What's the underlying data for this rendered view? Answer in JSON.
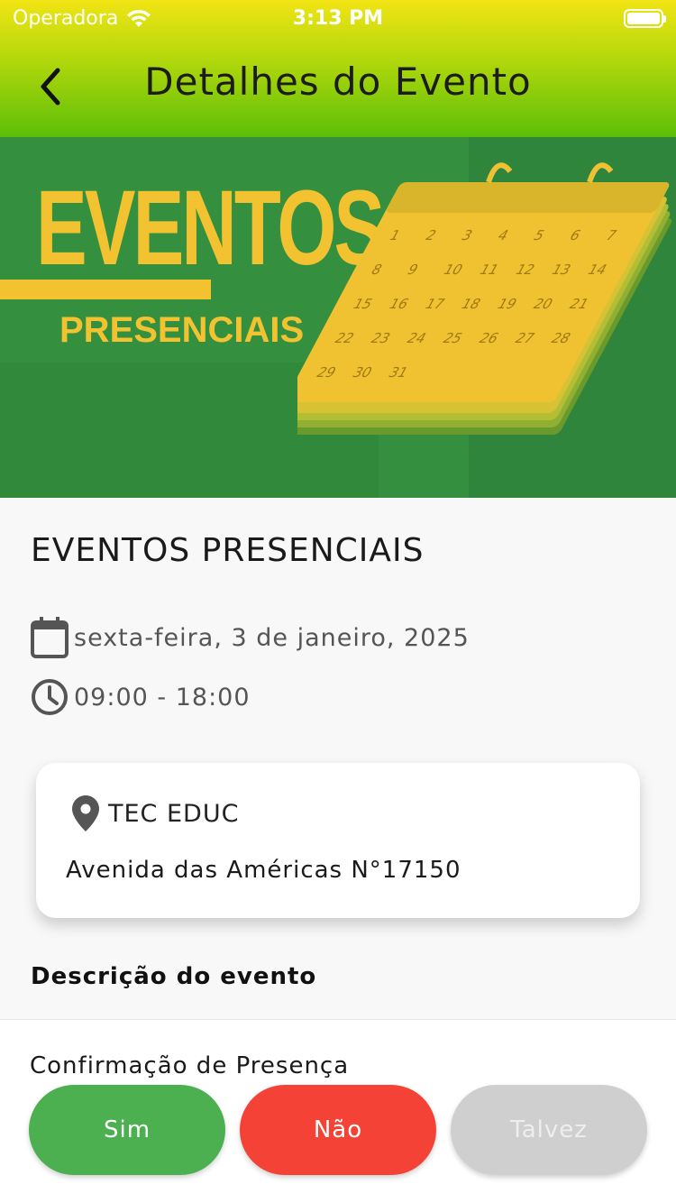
{
  "status_bar": {
    "carrier": "Operadora",
    "time": "3:13 PM"
  },
  "nav": {
    "title": "Detalhes do Evento"
  },
  "banner": {
    "title": "EVENTOS",
    "subtitle": "PRESENCIAIS",
    "calendar_days": [
      "1",
      "2",
      "3",
      "4",
      "5",
      "6",
      "7",
      "8",
      "9",
      "10",
      "11",
      "12",
      "13",
      "14",
      "15",
      "16",
      "17",
      "18",
      "19",
      "20",
      "21",
      "22",
      "23",
      "24",
      "25",
      "26",
      "27",
      "28",
      "29",
      "30",
      "31"
    ],
    "colors": {
      "background": "#3a9a44",
      "accent": "#f2c230"
    }
  },
  "event": {
    "title": "EVENTOS PRESENCIAIS",
    "date": "sexta-feira, 3 de janeiro, 2025",
    "time": "09:00 - 18:00"
  },
  "location": {
    "name": "TEC EDUC",
    "address": "Avenida das Américas N°17150"
  },
  "description": {
    "heading": "Descrição do evento"
  },
  "rsvp": {
    "label": "Confirmação de Presença",
    "buttons": {
      "yes": "Sim",
      "no": "Não",
      "maybe": "Talvez"
    },
    "colors": {
      "yes": "#4caf50",
      "no": "#f44336",
      "maybe": "#cfcfcf"
    }
  },
  "icons": {
    "back": "chevron-left-icon",
    "wifi": "wifi-icon",
    "battery": "battery-icon",
    "calendar": "calendar-icon",
    "clock": "clock-icon",
    "location": "location-pin-icon"
  }
}
